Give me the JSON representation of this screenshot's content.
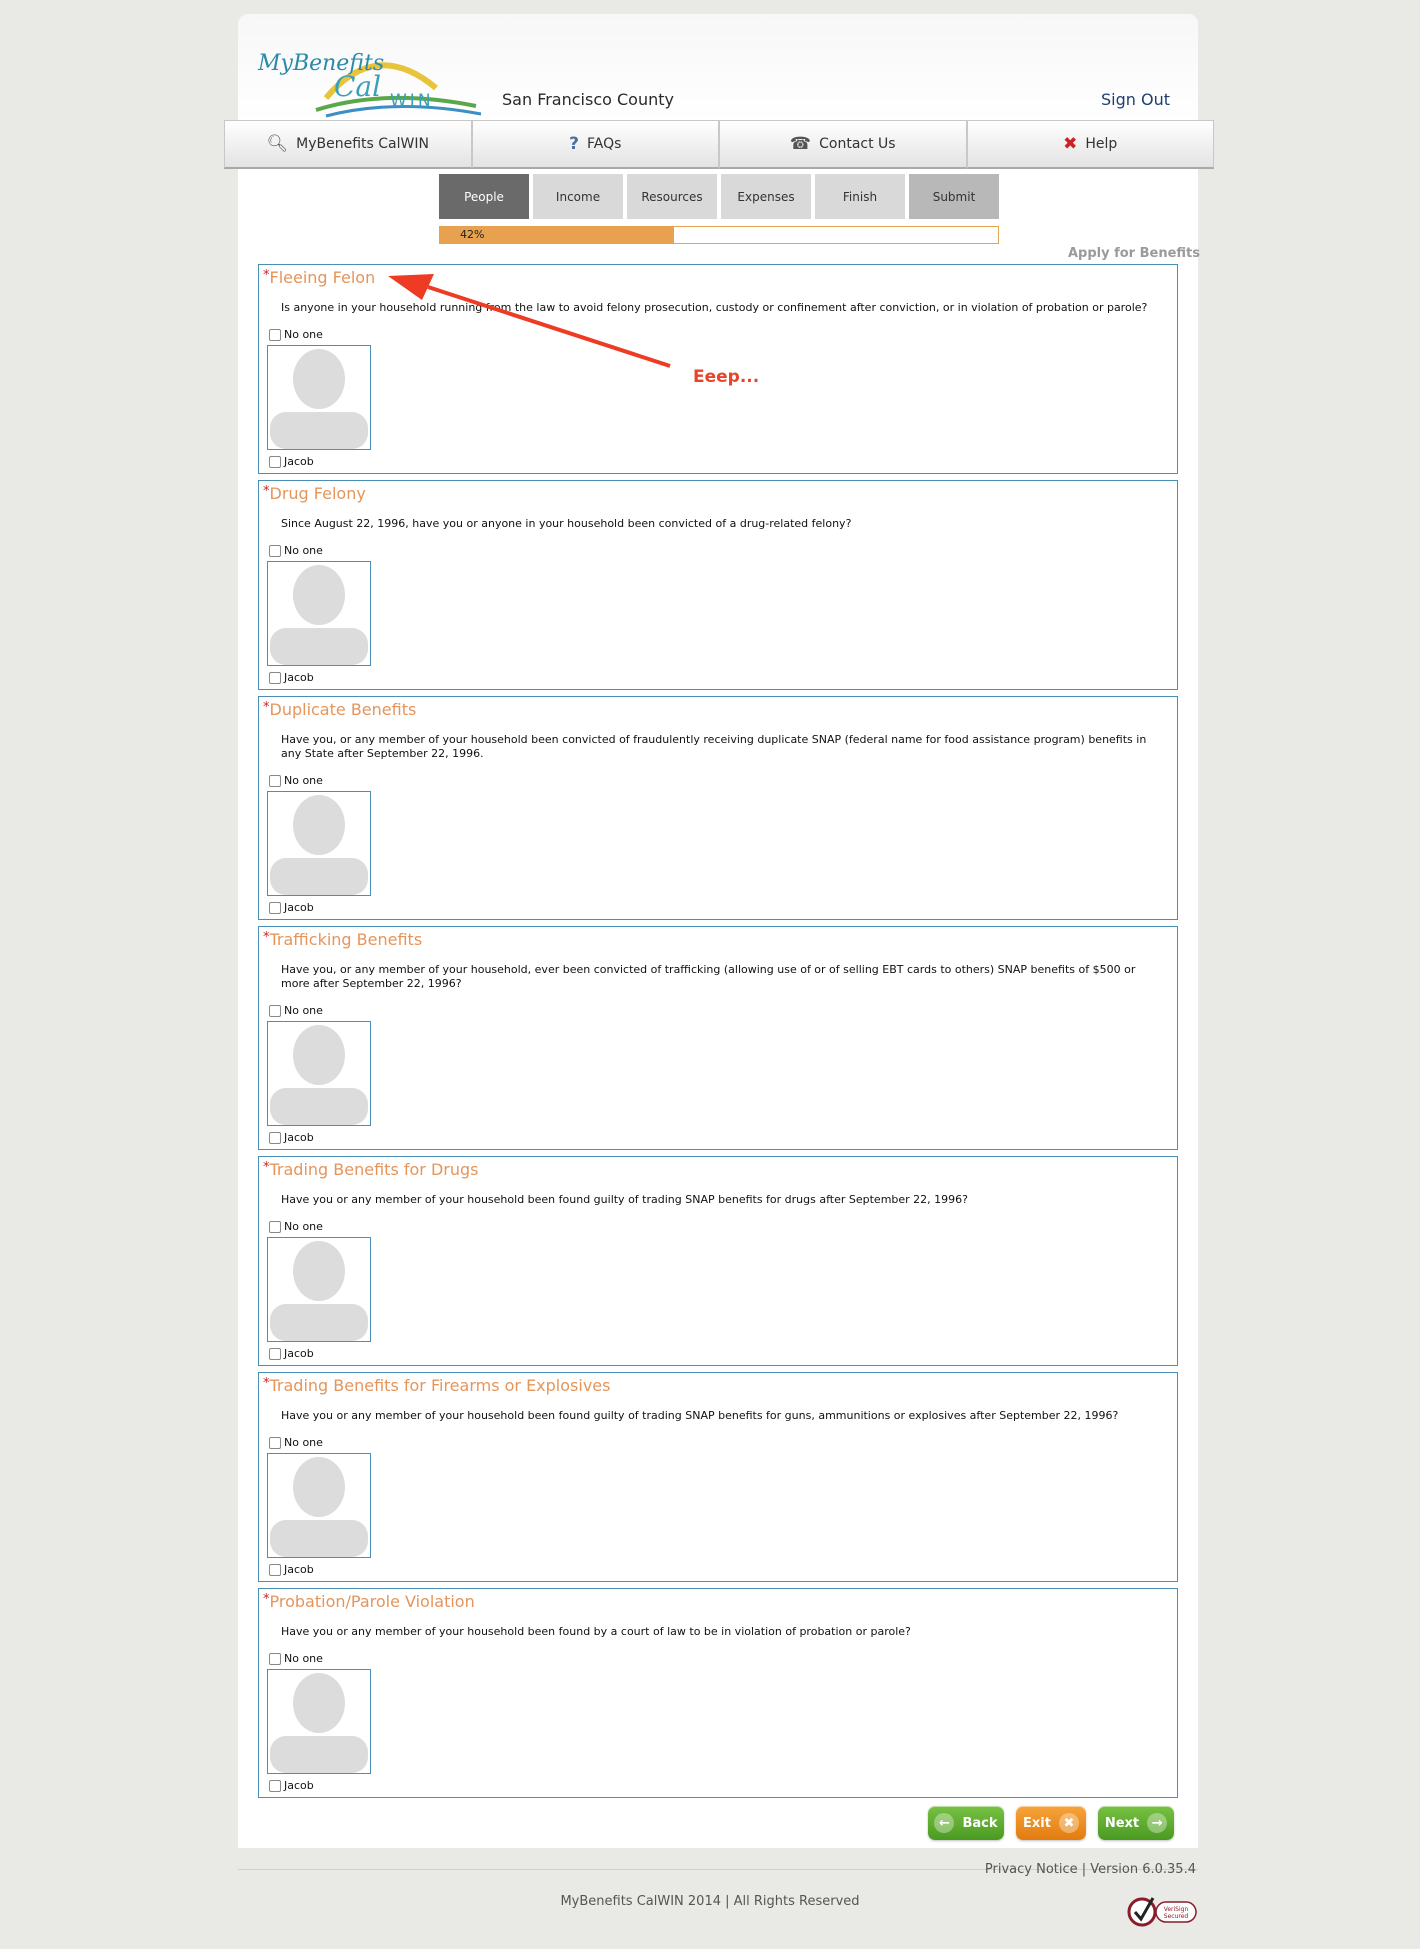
{
  "header": {
    "logo_text_1": "MyBenefits",
    "logo_text_2": "CalWIN",
    "county": "San Francisco County",
    "sign_out": "Sign Out"
  },
  "nav": [
    {
      "label": "MyBenefits CalWIN",
      "icon": "search-icon"
    },
    {
      "label": "FAQs",
      "icon": "question-icon"
    },
    {
      "label": "Contact Us",
      "icon": "phone-icon"
    },
    {
      "label": "Help",
      "icon": "help-icon"
    }
  ],
  "steps": [
    "People",
    "Income",
    "Resources",
    "Expenses",
    "Finish",
    "Submit"
  ],
  "active_step": "People",
  "progress": {
    "value": 0.42,
    "label": "42%"
  },
  "page_heading": "Apply for Benefits",
  "annotation_text": "Eeep...",
  "sections": [
    {
      "title": "Fleeing Felon",
      "question": "Is anyone in your household running from the law to avoid felony prosecution, custody or confinement after conviction, or in violation of probation or parole?",
      "no_one": "No one",
      "person": "Jacob"
    },
    {
      "title": "Drug Felony",
      "question": "Since August 22, 1996, have you or anyone in your household been convicted of a drug-related felony?",
      "no_one": "No one",
      "person": "Jacob"
    },
    {
      "title": "Duplicate Benefits",
      "question": "Have you, or any member of your household been convicted of fraudulently receiving duplicate SNAP (federal name for food assistance program) benefits in any State after September 22, 1996.",
      "no_one": "No one",
      "person": "Jacob"
    },
    {
      "title": "Trafficking Benefits",
      "question": "Have you, or any member of your household, ever been convicted of trafficking (allowing use of or of selling EBT cards to others) SNAP benefits of $500 or more after September 22, 1996?",
      "no_one": "No one",
      "person": "Jacob"
    },
    {
      "title": "Trading Benefits for Drugs",
      "question": "Have you or any member of your household been found guilty of trading SNAP benefits for drugs after September 22, 1996?",
      "no_one": "No one",
      "person": "Jacob"
    },
    {
      "title": "Trading Benefits for Firearms or Explosives",
      "question": "Have you or any member of your household been found guilty of trading SNAP benefits for guns, ammunitions or explosives after September 22, 1996?",
      "no_one": "No one",
      "person": "Jacob"
    },
    {
      "title": "Probation/Parole Violation",
      "question": "Have you or any member of your household been found by a court of law to be in violation of probation or parole?",
      "no_one": "No one",
      "person": "Jacob"
    }
  ],
  "buttons": {
    "back": "Back",
    "exit": "Exit",
    "next": "Next"
  },
  "footer": {
    "privacy": "Privacy Notice",
    "separator": "|",
    "version": "Version  6.0.35.4",
    "copyright": "MyBenefits CalWIN 2014 | All Rights Reserved",
    "seal_text_1": "VeriSign",
    "seal_text_2": "Secured"
  }
}
